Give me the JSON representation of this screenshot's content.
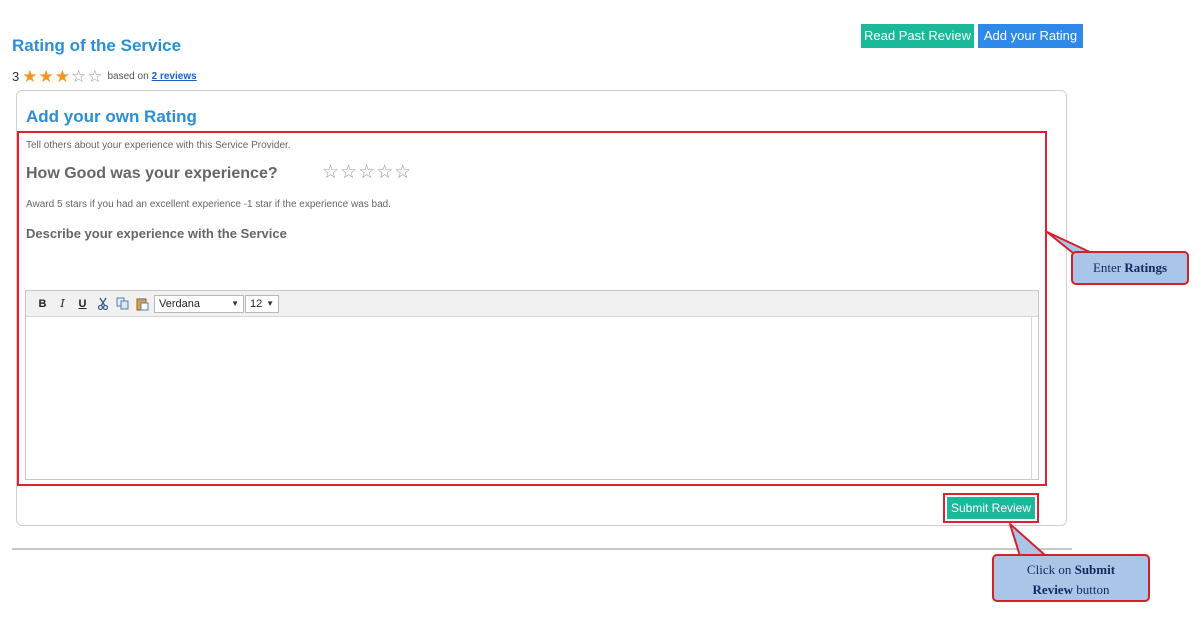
{
  "header": {
    "title": "Rating of the Service",
    "read_past_review": "Read Past Review",
    "add_your_rating": "Add your Rating"
  },
  "summary": {
    "score": "3",
    "stars_filled": 3,
    "stars_total": 5,
    "based_on": "based on",
    "reviews_link": "2 reviews"
  },
  "form": {
    "title": "Add your own Rating",
    "intro": "Tell others about your experience with this Service Provider.",
    "question": "How Good was your experience?",
    "rating_stars_total": 5,
    "hint": "Award 5 stars if you had an excellent experience -1 star if the experience was bad.",
    "describe_label": "Describe your experience with the Service",
    "editor": {
      "bold": "B",
      "italic": "I",
      "underline": "U",
      "font": "Verdana",
      "size": "12"
    },
    "submit": "Submit Review"
  },
  "callouts": {
    "ratings_prefix": "Enter ",
    "ratings_bold": "Ratings",
    "submit_line1_prefix": "Click on ",
    "submit_line1_bold": "Submit",
    "submit_line2_bold": "Review",
    "submit_line2_suffix": " button"
  },
  "colors": {
    "title_blue": "#2b8fd6",
    "teal": "#19b99a",
    "blue_button": "#2e89e8",
    "star_orange": "#f7941d",
    "highlight_red": "#e0202b",
    "callout_fill": "#a9c6e8"
  },
  "icons": [
    "star-filled-icon",
    "star-empty-icon",
    "cut-icon",
    "copy-icon",
    "paste-icon",
    "caret-down-icon"
  ]
}
